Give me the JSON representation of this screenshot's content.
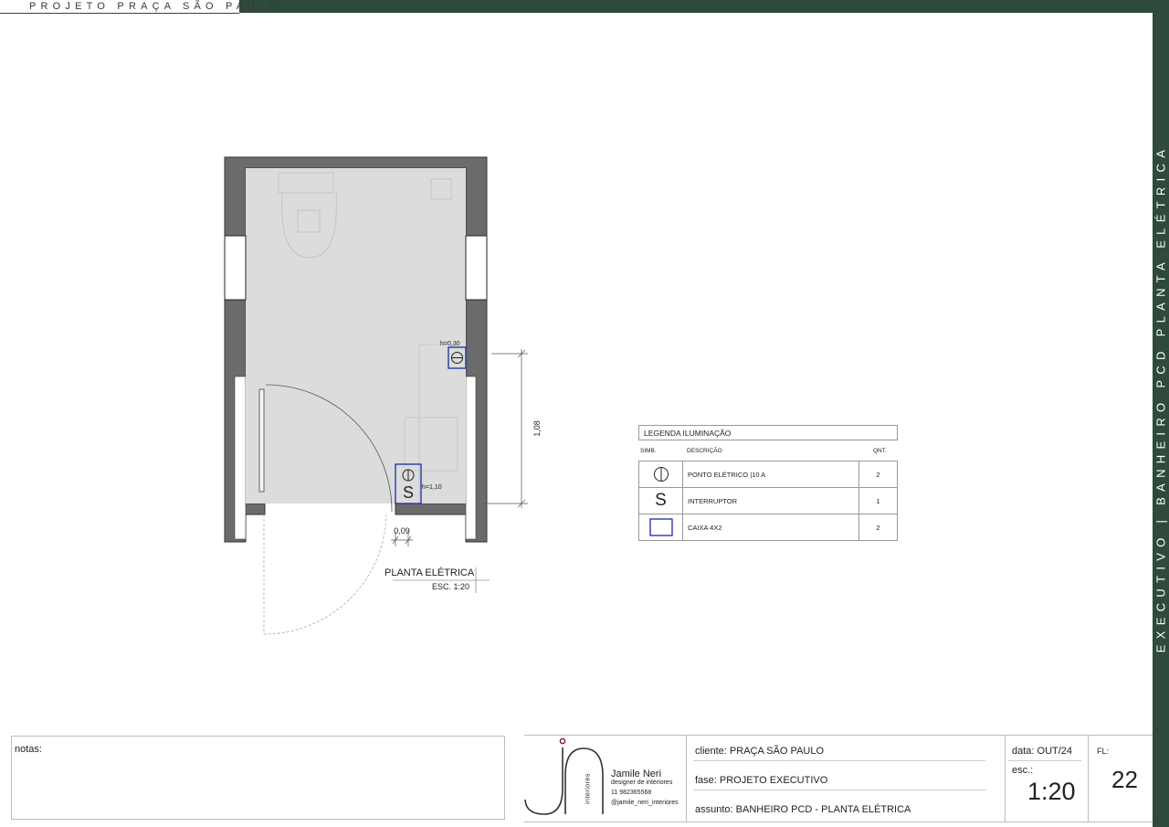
{
  "header": {
    "project_title": "PROJETO PRAÇA SÃO PAULO"
  },
  "sidebar": {
    "vertical_text": "EXECUTIVO | BANHEIRO PCD PLANTA ELÉTRICA"
  },
  "colors": {
    "brand_green": "#2d4a3a",
    "fixture_blue": "#1c2aa0",
    "floor_gray": "#dcdcdc",
    "wall_gray": "#6b6b6b"
  },
  "plan": {
    "title": "PLANTA ELÉTRICA",
    "scale": "ESC. 1:20",
    "annotations": {
      "h_outlet": "h=0,30",
      "h_switch": "h=1,10",
      "dim_vertical": "1,08",
      "dim_horizontal": "0,09"
    },
    "switch_symbol": "S"
  },
  "legend": {
    "title": "LEGENDA  ILUMINAÇÃO",
    "headers": {
      "symbol": "SIMB.",
      "description": "DESCRIÇÃO",
      "quantity": "QNT."
    },
    "rows": [
      {
        "icon": "outlet-symbol-icon",
        "description": "PONTO ELÉTRICO |10 A",
        "quantity": "2"
      },
      {
        "icon": "switch-symbol-icon",
        "symbol_text": "S",
        "description": "INTERRUPTOR",
        "quantity": "1"
      },
      {
        "icon": "box-4x2-icon",
        "description": "CAIXA 4X2",
        "quantity": "2"
      }
    ]
  },
  "notes": {
    "label": "notas:"
  },
  "titleblock": {
    "logo_word": "interiores",
    "designer_name": "Jamile Neri",
    "designer_role": "designer de interiores",
    "designer_phone": "11 982365568",
    "designer_instagram": "@jamile_neri_interiores",
    "cliente": "cliente: PRAÇA SÃO PAULO",
    "fase": "fase: PROJETO EXECUTIVO",
    "assunto": "assunto: BANHEIRO PCD - PLANTA ELÉTRICA",
    "data": "data: OUT/24",
    "esc_label": "esc.:",
    "esc_value": "1:20",
    "fl_label": "FL:",
    "sheet_number": "22"
  }
}
